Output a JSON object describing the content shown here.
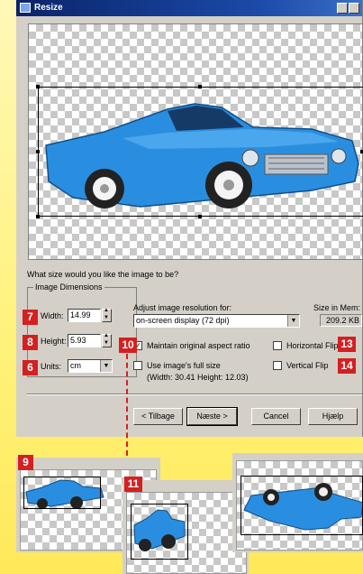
{
  "window": {
    "title": "Resize"
  },
  "question": "What size would you like the image to be?",
  "dimensions": {
    "legend": "Image Dimensions",
    "width_label": "Width:",
    "width_value": "14.99",
    "height_label": "Height:",
    "height_value": "5.93",
    "units_label": "Units:",
    "units_value": "cm"
  },
  "resolution": {
    "label": "Adjust image resolution for:",
    "value": "on-screen display  (72 dpi)"
  },
  "memory": {
    "label": "Size in Mem:",
    "value": "209.2 KB"
  },
  "options": {
    "maintain_aspect": "Maintain original aspect ratio",
    "maintain_checked": "✓",
    "full_size": "Use image's full size",
    "full_size_dims": "(Width: 30.41   Height: 12.03)",
    "horizontal_flip": "Horizontal Flip",
    "vertical_flip": "Vertical Flip"
  },
  "buttons": {
    "back": "< Tilbage",
    "next": "Næste >",
    "cancel": "Cancel",
    "help": "Hjælp"
  },
  "callouts": {
    "c6": "6",
    "c7": "7",
    "c8": "8",
    "c9": "9",
    "c10": "10",
    "c11": "11",
    "c13": "13",
    "c14": "14"
  },
  "colors": {
    "car": "#2a8ee0",
    "badge": "#d42020",
    "titlebar": "#0a246a"
  }
}
